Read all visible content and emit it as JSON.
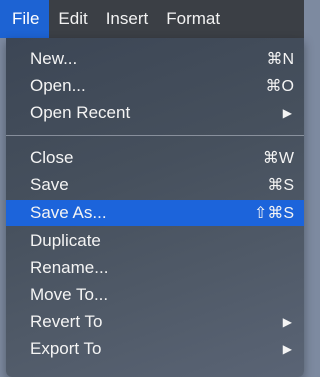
{
  "menubar": {
    "items": [
      "File",
      "Edit",
      "Insert",
      "Format"
    ],
    "active_index": 0
  },
  "menu": {
    "groups": [
      [
        {
          "label": "New...",
          "shortcut": "⌘N"
        },
        {
          "label": "Open...",
          "shortcut": "⌘O"
        },
        {
          "label": "Open Recent",
          "submenu": true,
          "arrow": "▶"
        }
      ],
      [
        {
          "label": "Close",
          "shortcut": "⌘W"
        },
        {
          "label": "Save",
          "shortcut": "⌘S"
        },
        {
          "label": "Save As...",
          "shortcut": "⇧⌘S",
          "highlighted": true
        },
        {
          "label": "Duplicate"
        },
        {
          "label": "Rename..."
        },
        {
          "label": "Move To..."
        },
        {
          "label": "Revert To",
          "submenu": true,
          "arrow": "▶"
        },
        {
          "label": "Export To",
          "submenu": true,
          "arrow": "▶"
        }
      ]
    ]
  },
  "colors": {
    "menubar_bg": "#3b3f45",
    "accent": "#1d63d3",
    "menu_bg": "#46505d"
  }
}
